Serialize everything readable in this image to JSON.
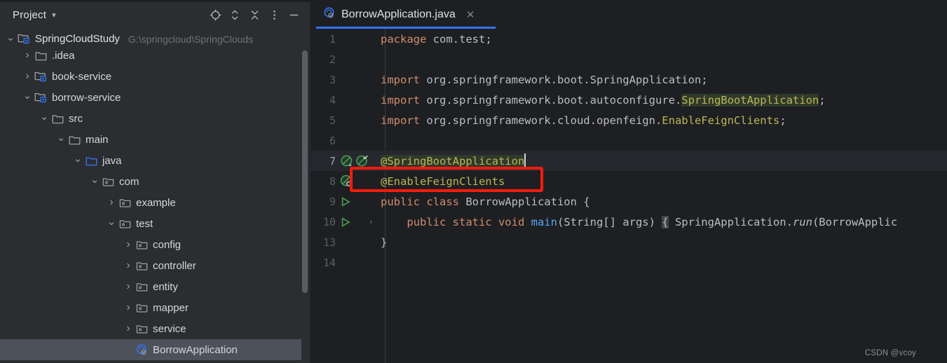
{
  "theme": {
    "panel_bg": "#2b2d30",
    "editor_bg": "#1e1f22",
    "caret_line_bg": "#26282e",
    "selection_bg": "#4d5159",
    "accent_blue": "#3574f0",
    "keyword_orange": "#cf8e6d",
    "annotation_yellow": "#bcb656",
    "method_blue": "#56a8f5",
    "text_default": "#bcbec4",
    "gutter_text": "#595e66",
    "highlight_box_red": "#fc1a0d",
    "identifier_highlight_bg": "#2f3a2a",
    "spring_bean_green": "#499c54"
  },
  "project_panel": {
    "title": "Project",
    "title_chevron": "chevron-down-icon",
    "toolbar_buttons": [
      {
        "name": "select-opened-file-icon",
        "label": "Select Opened File"
      },
      {
        "name": "expand-collapse-icon",
        "label": "Expand / Collapse"
      },
      {
        "name": "collapse-all-icon",
        "label": "Collapse All"
      },
      {
        "name": "more-options-icon",
        "label": "More Options"
      },
      {
        "name": "minimize-icon",
        "label": "Minimize"
      }
    ],
    "tree": [
      {
        "label": "SpringCloudStudy",
        "path": "G:\\springcloud\\SpringClouds",
        "indent": 0,
        "arrow": "collapse",
        "icon": "module-icon",
        "selected": false,
        "clipped": true
      },
      {
        "label": ".idea",
        "path": "",
        "indent": 1,
        "arrow": "expand",
        "icon": "folder-icon",
        "selected": false
      },
      {
        "label": "book-service",
        "path": "",
        "indent": 1,
        "arrow": "expand",
        "icon": "module-icon",
        "selected": false
      },
      {
        "label": "borrow-service",
        "path": "",
        "indent": 1,
        "arrow": "collapse",
        "icon": "module-icon",
        "selected": false
      },
      {
        "label": "src",
        "path": "",
        "indent": 2,
        "arrow": "collapse",
        "icon": "folder-icon",
        "selected": false
      },
      {
        "label": "main",
        "path": "",
        "indent": 3,
        "arrow": "collapse",
        "icon": "folder-icon",
        "selected": false
      },
      {
        "label": "java",
        "path": "",
        "indent": 4,
        "arrow": "collapse",
        "icon": "source-root-icon",
        "selected": false
      },
      {
        "label": "com",
        "path": "",
        "indent": 5,
        "arrow": "collapse",
        "icon": "package-icon",
        "selected": false
      },
      {
        "label": "example",
        "path": "",
        "indent": 6,
        "arrow": "expand",
        "icon": "package-icon",
        "selected": false
      },
      {
        "label": "test",
        "path": "",
        "indent": 6,
        "arrow": "collapse",
        "icon": "package-icon",
        "selected": false
      },
      {
        "label": "config",
        "path": "",
        "indent": 7,
        "arrow": "expand",
        "icon": "package-icon",
        "selected": false
      },
      {
        "label": "controller",
        "path": "",
        "indent": 7,
        "arrow": "expand",
        "icon": "package-icon",
        "selected": false
      },
      {
        "label": "entity",
        "path": "",
        "indent": 7,
        "arrow": "expand",
        "icon": "package-icon",
        "selected": false
      },
      {
        "label": "mapper",
        "path": "",
        "indent": 7,
        "arrow": "expand",
        "icon": "package-icon",
        "selected": false
      },
      {
        "label": "service",
        "path": "",
        "indent": 7,
        "arrow": "expand",
        "icon": "package-icon",
        "selected": false
      },
      {
        "label": "BorrowApplication",
        "path": "",
        "indent": 7,
        "arrow": "none",
        "icon": "spring-class-icon",
        "selected": true
      }
    ]
  },
  "editor": {
    "tab": {
      "filename": "BorrowApplication.java",
      "icon": "spring-class-icon",
      "close_icon": "close-icon",
      "active": true
    },
    "caret": {
      "line": 7,
      "column": 23
    },
    "lines": [
      {
        "num": "1",
        "gutter": [],
        "fold": false,
        "caret_line": false,
        "tokens": [
          {
            "t": "package",
            "c": "kw"
          },
          {
            "t": " com.test;",
            "c": "id"
          }
        ]
      },
      {
        "num": "2",
        "gutter": [],
        "fold": false,
        "caret_line": false,
        "tokens": []
      },
      {
        "num": "3",
        "gutter": [],
        "fold": false,
        "caret_line": false,
        "tokens": [
          {
            "t": "import",
            "c": "kw"
          },
          {
            "t": " org.springframework.boot.SpringApplication;",
            "c": "id"
          }
        ]
      },
      {
        "num": "4",
        "gutter": [],
        "fold": false,
        "caret_line": false,
        "tokens": [
          {
            "t": "import",
            "c": "kw"
          },
          {
            "t": " org.springframework.boot.autoconfigure.",
            "c": "id"
          },
          {
            "t": "SpringBootApplication",
            "c": "annh"
          },
          {
            "t": ";",
            "c": "id"
          }
        ]
      },
      {
        "num": "5",
        "gutter": [],
        "fold": false,
        "caret_line": false,
        "tokens": [
          {
            "t": "import",
            "c": "kw"
          },
          {
            "t": " org.springframework.cloud.openfeign.",
            "c": "id"
          },
          {
            "t": "EnableFeignClients",
            "c": "ann"
          },
          {
            "t": ";",
            "c": "id"
          }
        ]
      },
      {
        "num": "6",
        "gutter": [],
        "fold": false,
        "caret_line": false,
        "tokens": []
      },
      {
        "num": "7",
        "gutter": [
          "spring-bean-icon",
          "spring-bean-check-icon"
        ],
        "fold": false,
        "caret_line": true,
        "tokens": [
          {
            "t": "@SpringBootApplication",
            "c": "annh"
          }
        ]
      },
      {
        "num": "8",
        "gutter": [
          "spring-bean-search-icon"
        ],
        "fold": false,
        "caret_line": false,
        "tokens": [
          {
            "t": "@EnableFeignClients",
            "c": "ann"
          }
        ]
      },
      {
        "num": "9",
        "gutter": [
          "run-gutter-icon"
        ],
        "fold": false,
        "caret_line": false,
        "tokens": [
          {
            "t": "public class ",
            "c": "kw"
          },
          {
            "t": "BorrowApplication {",
            "c": "id"
          }
        ]
      },
      {
        "num": "10",
        "gutter": [
          "run-gutter-icon"
        ],
        "fold": true,
        "caret_line": false,
        "tokens": [
          {
            "t": "    public static void ",
            "c": "kw"
          },
          {
            "t": "main",
            "c": "mth"
          },
          {
            "t": "(String[] args) ",
            "c": "id"
          },
          {
            "t": "{",
            "c": "fold-ph"
          },
          {
            "t": " SpringApplication.",
            "c": "id"
          },
          {
            "t": "run",
            "c": "ital"
          },
          {
            "t": "(BorrowApplic",
            "c": "id"
          }
        ]
      },
      {
        "num": "13",
        "gutter": [],
        "fold": false,
        "caret_line": false,
        "tokens": [
          {
            "t": "}",
            "c": "id"
          }
        ]
      },
      {
        "num": "14",
        "gutter": [],
        "fold": false,
        "caret_line": false,
        "tokens": []
      }
    ],
    "highlight_box": {
      "name": "annotation-highlight-box",
      "target_line": "8",
      "target_text": "@EnableFeignClients",
      "color": "#fc1a0d"
    }
  },
  "watermark": "CSDN @vcoy"
}
